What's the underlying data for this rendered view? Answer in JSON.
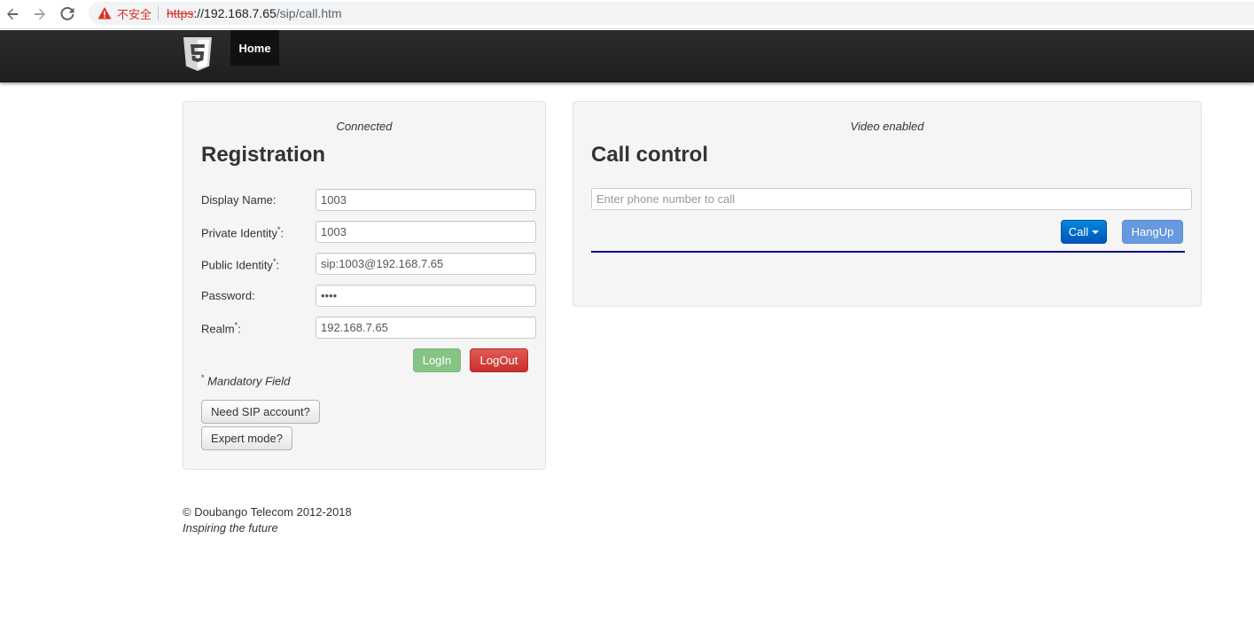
{
  "browser": {
    "insecure_label": "不安全",
    "url_scheme": "https",
    "url_host": "://192.168.7.65",
    "url_path": "/sip/call.htm"
  },
  "navbar": {
    "logo_icon": "html5-logo-icon",
    "home_label": "Home"
  },
  "registration": {
    "status": "Connected",
    "title": "Registration",
    "fields": [
      {
        "label": "Display Name:",
        "value": "1003",
        "required": false
      },
      {
        "label": "Private Identity",
        "value": "1003",
        "required": true
      },
      {
        "label": "Public Identity",
        "value": "sip:1003@192.168.7.65",
        "required": true
      },
      {
        "label": "Password:",
        "value": "••••",
        "required": false
      },
      {
        "label": "Realm",
        "value": "192.168.7.65",
        "required": true
      }
    ],
    "login_label": "LogIn",
    "logout_label": "LogOut",
    "mandatory_note": "Mandatory Field",
    "sip_account_label": "Need SIP account?",
    "expert_mode_label": "Expert mode?"
  },
  "call_control": {
    "status": "Video enabled",
    "title": "Call control",
    "phone_placeholder": "Enter phone number to call",
    "phone_value": "",
    "call_label": "Call",
    "hangup_label": "HangUp",
    "divider_color": "#000080"
  },
  "footer": {
    "copyright": "© Doubango Telecom 2012-2018",
    "tagline": "Inspiring the future"
  }
}
